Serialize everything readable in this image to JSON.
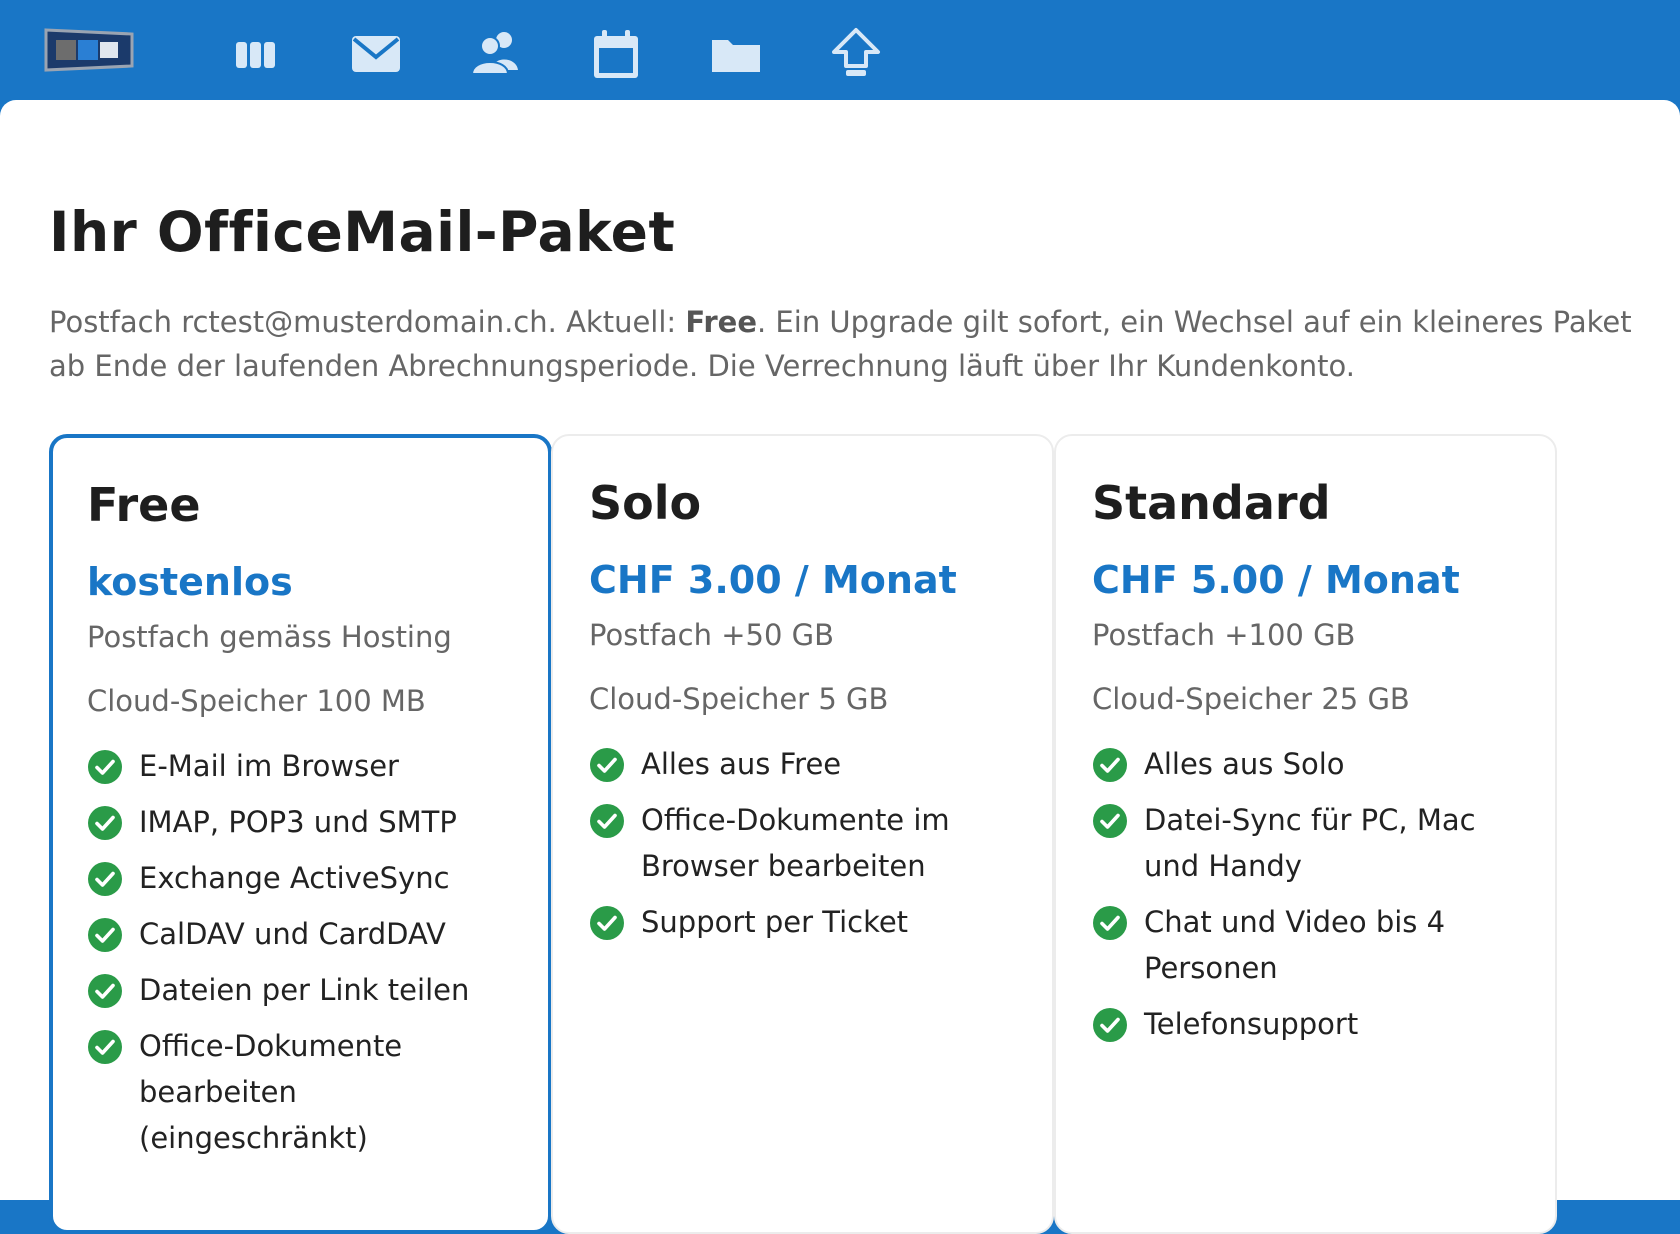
{
  "topbar": {
    "nav": [
      {
        "icon": "apps-icon"
      },
      {
        "icon": "mail-icon"
      },
      {
        "icon": "contacts-icon"
      },
      {
        "icon": "calendar-icon"
      },
      {
        "icon": "folder-icon"
      },
      {
        "icon": "upgrade-icon"
      }
    ]
  },
  "colors": {
    "brand": "#1976c6",
    "check": "#2a9b48"
  },
  "page": {
    "title": "Ihr OfficeMail-Paket",
    "intro_prefix": "Postfach rctest@musterdomain.ch. Aktuell: ",
    "intro_current": "Free",
    "intro_suffix": ". Ein Upgrade gilt sofort, ein Wechsel auf ein kleineres Paket ab Ende der laufenden Abrechnungsperiode. Die Verrechnung läuft über Ihr Kundenkonto."
  },
  "plans": [
    {
      "name": "Free",
      "price": "kostenlos",
      "mailbox": "Postfach gemäss Hosting",
      "cloud": "Cloud-Speicher 100 MB",
      "current": true,
      "features": [
        "E-Mail im Browser",
        "IMAP, POP3 und SMTP",
        "Exchange ActiveSync",
        "CalDAV und CardDAV",
        "Dateien per Link teilen",
        "Office-Dokumente bearbeiten (eingeschränkt)"
      ]
    },
    {
      "name": "Solo",
      "price": "CHF 3.00 / Monat",
      "mailbox": "Postfach +50 GB",
      "cloud": "Cloud-Speicher 5 GB",
      "current": false,
      "features": [
        "Alles aus Free",
        "Office-Dokumente im Browser bearbeiten",
        "Support per Ticket"
      ]
    },
    {
      "name": "Standard",
      "price": "CHF 5.00 / Monat",
      "mailbox": "Postfach +100 GB",
      "cloud": "Cloud-Speicher 25 GB",
      "current": false,
      "features": [
        "Alles aus Solo",
        "Datei-Sync für PC, Mac und Handy",
        "Chat und Video bis 4 Personen",
        "Telefonsupport"
      ]
    }
  ]
}
